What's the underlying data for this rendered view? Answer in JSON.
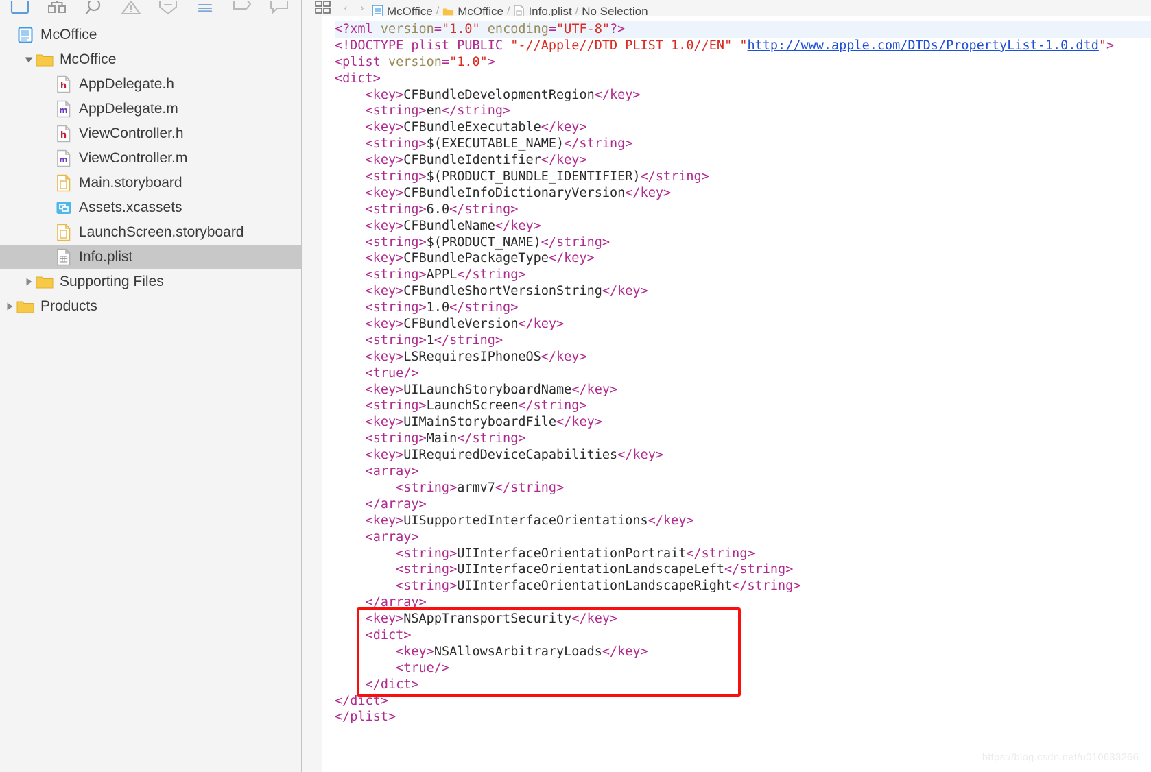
{
  "toolbar": {
    "icons": [
      {
        "name": "folder-navigator-icon",
        "label": "Project navigator",
        "selected": true
      },
      {
        "name": "symbol-navigator-icon",
        "label": "Symbol navigator",
        "selected": false
      },
      {
        "name": "search-navigator-icon",
        "label": "Find navigator",
        "selected": false
      },
      {
        "name": "issue-navigator-icon",
        "label": "Issue navigator",
        "selected": false
      },
      {
        "name": "test-navigator-icon",
        "label": "Test navigator",
        "selected": false
      },
      {
        "name": "debug-navigator-icon",
        "label": "Debug navigator",
        "selected": false
      },
      {
        "name": "breakpoint-navigator-icon",
        "label": "Breakpoint navigator",
        "selected": false
      },
      {
        "name": "report-navigator-icon",
        "label": "Report navigator",
        "selected": false
      }
    ],
    "related_items_label": "Related items",
    "back_label": "Back",
    "forward_label": "Forward"
  },
  "breadcrumb": {
    "separator": "/",
    "items": [
      {
        "label": "McOffice",
        "icon": "project-icon"
      },
      {
        "label": "McOffice",
        "icon": "folder-icon"
      },
      {
        "label": "Info.plist",
        "icon": "plist-file-icon"
      },
      {
        "label": "No Selection",
        "icon": "none"
      }
    ]
  },
  "sidebar": {
    "rows": [
      {
        "label": "McOffice",
        "indent": 0,
        "icon": "project-icon",
        "disclosure": "none",
        "selected": false
      },
      {
        "label": "McOffice",
        "indent": 1,
        "icon": "folder-icon",
        "disclosure": "expanded",
        "selected": false
      },
      {
        "label": "AppDelegate.h",
        "indent": 2,
        "icon": "header-file-icon",
        "disclosure": "none",
        "selected": false
      },
      {
        "label": "AppDelegate.m",
        "indent": 2,
        "icon": "source-file-icon",
        "disclosure": "none",
        "selected": false
      },
      {
        "label": "ViewController.h",
        "indent": 2,
        "icon": "header-file-icon",
        "disclosure": "none",
        "selected": false
      },
      {
        "label": "ViewController.m",
        "indent": 2,
        "icon": "source-file-icon",
        "disclosure": "none",
        "selected": false
      },
      {
        "label": "Main.storyboard",
        "indent": 2,
        "icon": "storyboard-icon",
        "disclosure": "none",
        "selected": false
      },
      {
        "label": "Assets.xcassets",
        "indent": 2,
        "icon": "xcassets-icon",
        "disclosure": "none",
        "selected": false
      },
      {
        "label": "LaunchScreen.storyboard",
        "indent": 2,
        "icon": "storyboard-icon",
        "disclosure": "none",
        "selected": false
      },
      {
        "label": "Info.plist",
        "indent": 2,
        "icon": "plist-file-icon",
        "disclosure": "none",
        "selected": true
      },
      {
        "label": "Supporting Files",
        "indent": 1,
        "icon": "folder-icon",
        "disclosure": "collapsed",
        "selected": false
      },
      {
        "label": "Products",
        "indent": 0,
        "icon": "folder-icon",
        "disclosure": "collapsed",
        "selected": false
      }
    ]
  },
  "editor": {
    "filename": "Info.plist",
    "highlight_note": "NSAppTransportSecurity block outlined in red",
    "annotation_color": "#fa0f0f",
    "code_lines": [
      "<?xml version=\"1.0\" encoding=\"UTF-8\"?>",
      "<!DOCTYPE plist PUBLIC \"-//Apple//DTD PLIST 1.0//EN\" \"http://www.apple.com/DTDs/PropertyList-1.0.dtd\">",
      "<plist version=\"1.0\">",
      "<dict>",
      "\t<key>CFBundleDevelopmentRegion</key>",
      "\t<string>en</string>",
      "\t<key>CFBundleExecutable</key>",
      "\t<string>$(EXECUTABLE_NAME)</string>",
      "\t<key>CFBundleIdentifier</key>",
      "\t<string>$(PRODUCT_BUNDLE_IDENTIFIER)</string>",
      "\t<key>CFBundleInfoDictionaryVersion</key>",
      "\t<string>6.0</string>",
      "\t<key>CFBundleName</key>",
      "\t<string>$(PRODUCT_NAME)</string>",
      "\t<key>CFBundlePackageType</key>",
      "\t<string>APPL</string>",
      "\t<key>CFBundleShortVersionString</key>",
      "\t<string>1.0</string>",
      "\t<key>CFBundleVersion</key>",
      "\t<string>1</string>",
      "\t<key>LSRequiresIPhoneOS</key>",
      "\t<true/>",
      "\t<key>UILaunchStoryboardName</key>",
      "\t<string>LaunchScreen</string>",
      "\t<key>UIMainStoryboardFile</key>",
      "\t<string>Main</string>",
      "\t<key>UIRequiredDeviceCapabilities</key>",
      "\t<array>",
      "\t\t<string>armv7</string>",
      "\t</array>",
      "\t<key>UISupportedInterfaceOrientations</key>",
      "\t<array>",
      "\t\t<string>UIInterfaceOrientationPortrait</string>",
      "\t\t<string>UIInterfaceOrientationLandscapeLeft</string>",
      "\t\t<string>UIInterfaceOrientationLandscapeRight</string>",
      "\t</array>",
      "\t<key>NSAppTransportSecurity</key>",
      "\t<dict>",
      "\t\t<key>NSAllowsArbitraryLoads</key>",
      "\t\t<true/>",
      "\t</dict>",
      "</dict>",
      "</plist>"
    ],
    "syntax_colors": {
      "tag": "#b02a8f",
      "attribute_name": "#9a8a55",
      "attribute_value": "#d92b21",
      "text": "#2b2b2b",
      "link": "#1d4fd8",
      "current_line_background": "#eef4fc"
    }
  },
  "watermark": {
    "text": "https://blog.csdn.net/u010633266"
  }
}
